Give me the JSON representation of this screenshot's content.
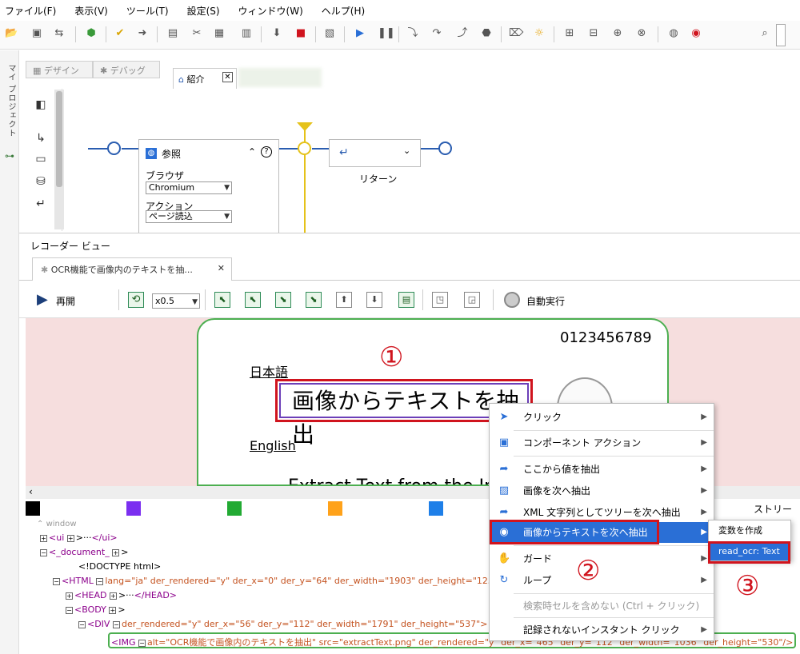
{
  "menubar": [
    "ファイル(F)",
    "表示(V)",
    "ツール(T)",
    "設定(S)",
    "ウィンドウ(W)",
    "ヘルプ(H)"
  ],
  "sidebar": {
    "label": "マイ プロジェクト"
  },
  "design_tabs": {
    "design": "デザイン",
    "debug": "デバッグ",
    "intro": "紹介"
  },
  "flow": {
    "ref_title": "参照",
    "browser_label": "ブラウザ",
    "browser_value": "Chromium",
    "action_label": "アクション",
    "action_value": "ページ読込",
    "return_label": "リターン"
  },
  "recorder": {
    "title": "レコーダー ビュー",
    "tab_label": "OCR機能で画像内のテキストを抽...",
    "resume": "再開",
    "speed": "x0.5",
    "autorun": "自動実行"
  },
  "preview": {
    "numbers": "0123456789",
    "jp_label": "日本語",
    "jp_text": "画像からテキストを抽出",
    "en_label": "English",
    "en_text": "Extract Text from the Image"
  },
  "colors": {
    "swatches": [
      "#000000",
      "#7b2ff0",
      "#22aa33",
      "#ffa21a",
      "#1e7fe8"
    ],
    "accent": "#2a6fd6",
    "annotation": "#d0141e"
  },
  "stream_label": "ストリーム",
  "tree": {
    "window": "window",
    "ui": "<ui",
    "ui_close": "</ui>",
    "document": "<_document_",
    "doctype": "<!DOCTYPE html>",
    "html_open": "<HTML",
    "html_attrs": "lang=\"ja\" der_rendered=\"y\" der_x=\"0\" der_y=\"64\" der_width=\"1903\" der_height=\"1256",
    "head": "<HEAD",
    "head_close": "</HEAD>",
    "body": "<BODY",
    "div": "<DIV",
    "div_attrs": "der_rendered=\"y\" der_x=\"56\" der_y=\"112\" der_width=\"1791\" der_height=\"537\">",
    "img": "<IMG",
    "img_attrs": "alt=\"OCR機能で画像内のテキストを抽出\" src=\"extractText.png\" der_rendered=\"y\" der_x=\"465\" der_y=\"112\" der_width=\"1036\" der_height=\"530\"/>"
  },
  "context_menu": [
    {
      "label": "クリック",
      "submenu": true
    },
    {
      "label": "コンポーネント アクション",
      "submenu": true
    },
    {
      "label": "ここから値を抽出",
      "submenu": true
    },
    {
      "label": "画像を次へ抽出",
      "submenu": true
    },
    {
      "label": "XML 文字列としてツリーを次へ抽出",
      "submenu": true
    },
    {
      "label": "画像からテキストを次へ抽出",
      "submenu": true,
      "highlighted": true
    },
    {
      "label": "ガード",
      "submenu": true
    },
    {
      "label": "ループ",
      "submenu": true
    },
    {
      "label": "検索時セルを含めない (Ctrl + クリック)",
      "disabled": true
    },
    {
      "label": "記録されないインスタント クリック",
      "submenu": true
    }
  ],
  "submenu": {
    "create_var": "変数を作成",
    "read_ocr": "read_ocr: Text"
  },
  "annotations": [
    "①",
    "②",
    "③"
  ]
}
